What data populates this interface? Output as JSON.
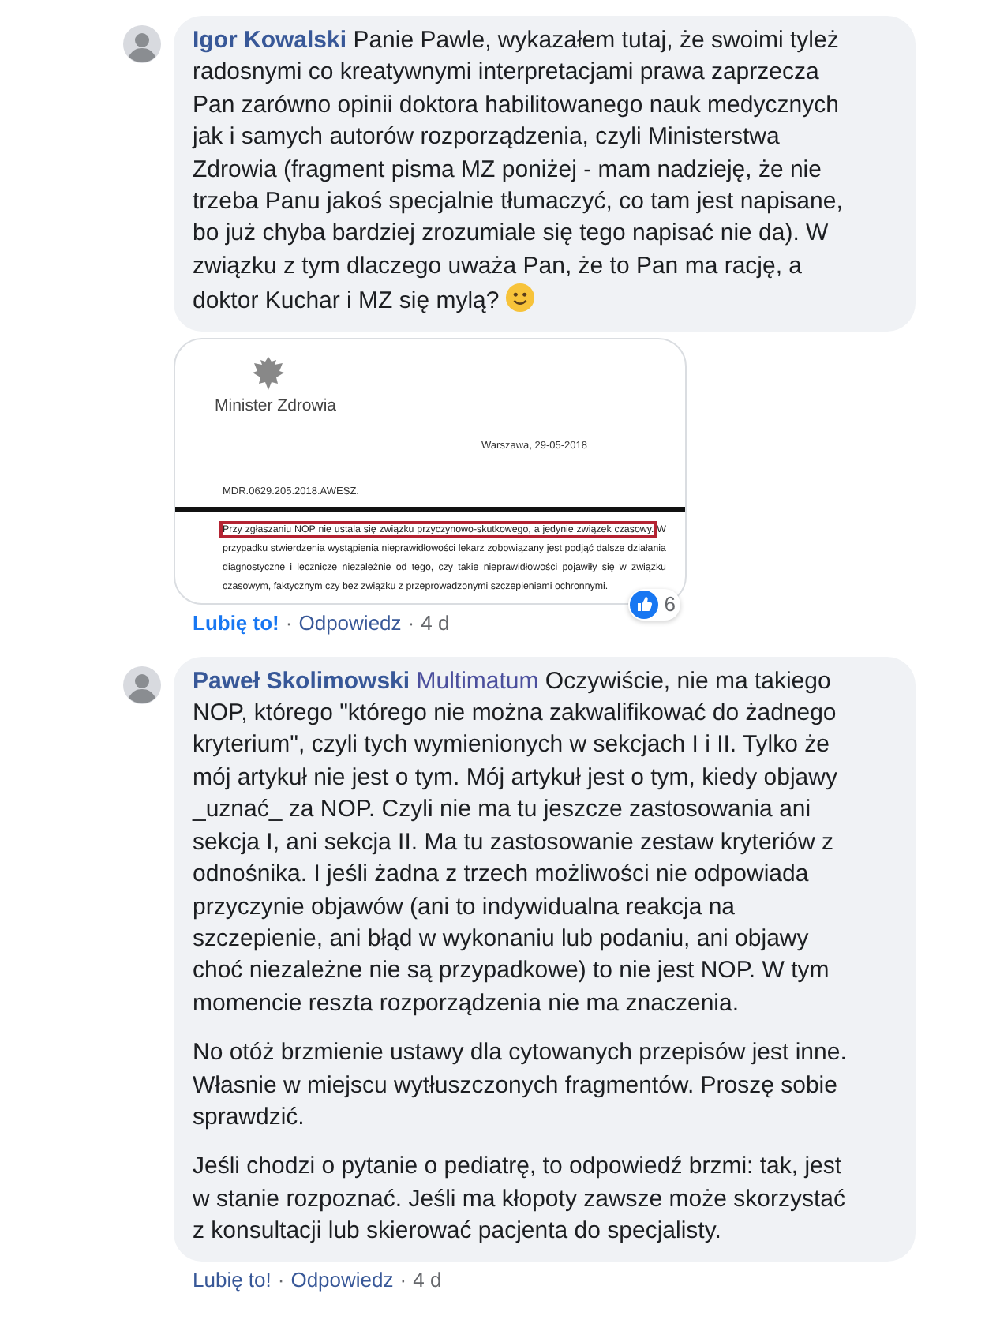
{
  "comments": [
    {
      "author": "Igor Kowalski",
      "paragraphs": [
        "Panie Pawle, wykazałem tutaj, że swoimi tyleż radosnymi co kreatywnymi interpretacjami prawa zaprzecza Pan zarówno opinii doktora habilitowanego nauk medycznych jak i samych autorów rozporządzenia, czyli Ministerstwa Zdrowia (fragment pisma MZ poniżej - mam nadzieję, że nie trzeba Panu jakoś specjalnie tłumaczyć, co tam jest napisane, bo już chyba bardziej zrozumiale się tego napisać nie da). W związku z tym dlaczego uważa Pan, że to Pan ma rację, a doktor Kuchar i MZ się mylą?"
      ],
      "ends_with_smiley": true,
      "attachment": {
        "header": "Minister Zdrowia",
        "place_date": "Warszawa, 29-05-2018",
        "reference": "MDR.0629.205.2018.AWESZ.",
        "highlighted": "Przy zgłaszaniu NOP nie ustala się związku przyczynowo-skutkowego, a jedynie związek czasowy.",
        "rest": " W przypadku stwierdzenia wystąpienia nieprawidłowości lekarz zobowiązany jest podjąć dalsze działania diagnostyczne i lecznicze niezależnie od tego, czy takie nieprawidłowości pojawiły się w związku czasowym, faktycznym czy bez związku z przeprowadzonymi szczepieniami ochronnymi."
      },
      "reactions": "6",
      "like_label": "Lubię to!",
      "liked": true,
      "separator": "·",
      "reply_label": "Odpowiedz",
      "time": "4 d"
    },
    {
      "author": "Paweł Skolimowski",
      "badge": "Multimatum",
      "paragraphs": [
        "Oczywiście, nie ma takiego NOP, którego \"którego nie można zakwalifikować do żadnego kryterium\", czyli tych wymienionych w sekcjach I i II. Tylko że mój artykuł nie jest o tym. Mój artykuł jest o tym, kiedy objawy _uznać_ za NOP. Czyli nie ma tu jeszcze zastosowania ani sekcja I, ani sekcja II. Ma tu zastosowanie zestaw kryteriów z odnośnika. I jeśli żadna z trzech możliwości nie odpowiada przyczynie objawów (ani to indywidualna reakcja na szczepienie, ani błąd w wykonaniu lub podaniu, ani objawy choć niezależne nie są przypadkowe) to nie jest NOP. W tym momencie reszta rozporządzenia nie ma znaczenia.",
        "No otóż brzmienie ustawy dla cytowanych przepisów jest inne. Własnie w miejscu wytłuszczonych fragmentów. Proszę sobie sprawdzić.",
        "Jeśli chodzi o pytanie o pediatrę, to odpowiedź brzmi: tak, jest w stanie rozpoznać. Jeśli ma kłopoty zawsze może skorzystać z konsultacji lub skierować pacjenta do specjalisty."
      ],
      "ends_with_smiley": false,
      "like_label": "Lubię to!",
      "liked": false,
      "separator": "·",
      "reply_label": "Odpowiedz",
      "time": "4 d"
    }
  ]
}
